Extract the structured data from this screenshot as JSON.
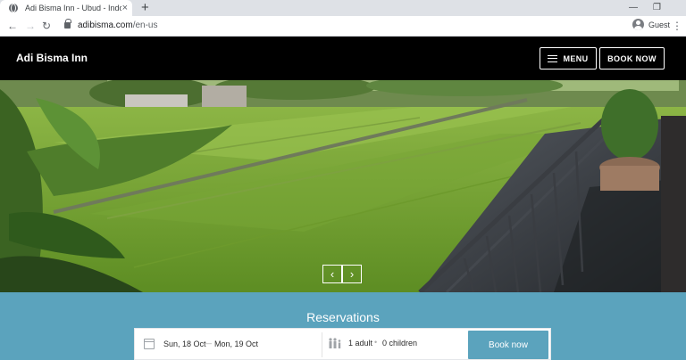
{
  "browser": {
    "tab_title": "Adi Bisma Inn - Ubud - Indonesia",
    "tab_close": "×",
    "new_tab": "+",
    "url_host": "adibisma.com",
    "url_path": "/en-us",
    "profile_label": "Guest",
    "minimize": "—",
    "maximize": "❐",
    "back": "←",
    "forward": "→",
    "reload": "↻",
    "menu": "⋮"
  },
  "header": {
    "brand": "Adi Bisma Inn",
    "menu_label": "MENU",
    "book_label": "BOOK NOW"
  },
  "hero": {
    "prev_arrow": "‹",
    "next_arrow": "›"
  },
  "reservations": {
    "title": "Reservations",
    "check_in": "Sun, 18 Oct",
    "separator": "—",
    "check_out": "Mon, 19 Oct",
    "adults": "1 adult",
    "dot": "•",
    "children": "0 children",
    "submit_label": "Book now"
  },
  "colors": {
    "header_bg": "#000000",
    "accent": "#5ba3bd"
  }
}
